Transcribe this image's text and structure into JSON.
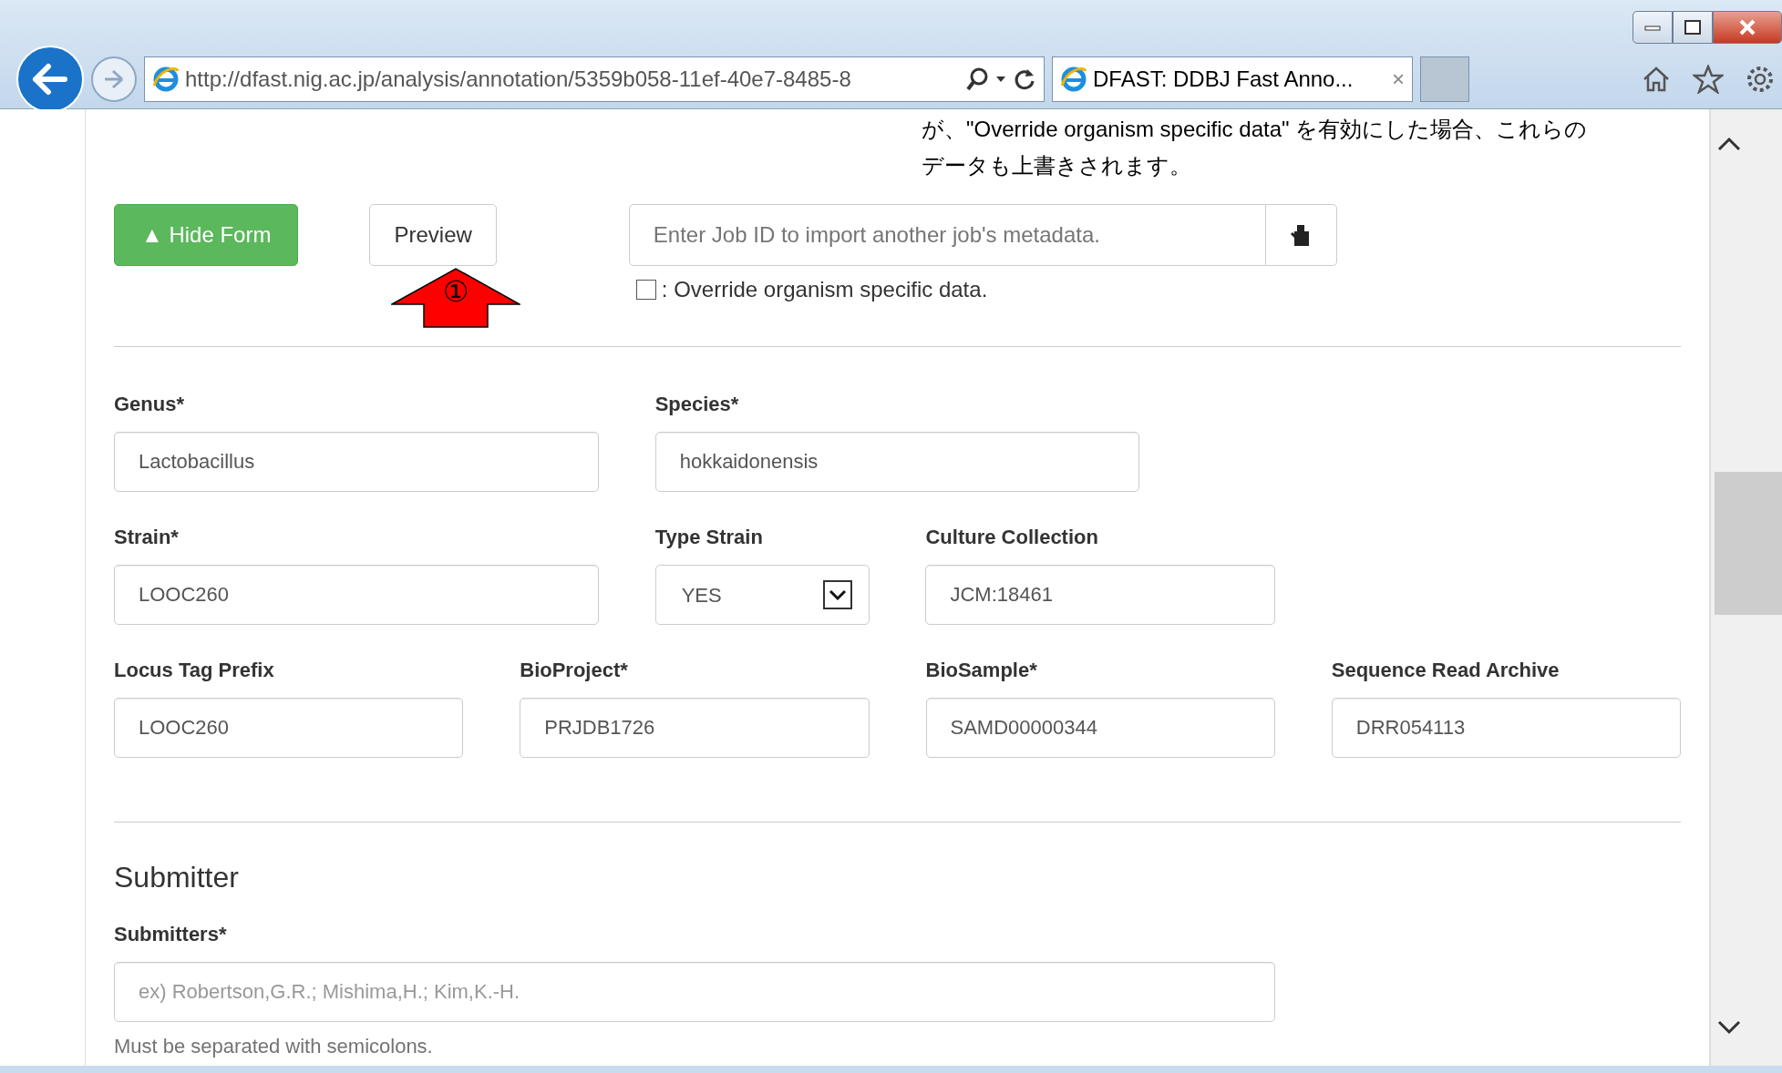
{
  "browser": {
    "address": "http://dfast.nig.ac.jp/analysis/annotation/5359b058-11ef-40e7-8485-8",
    "tab": {
      "title": "DFAST: DDBJ Fast Anno...",
      "close": "×"
    }
  },
  "note": [
    "が、\"Override organism specific data\" を有効にした場合、これらの",
    "データも上書きされます。"
  ],
  "actions": {
    "hide_form": "▲ Hide Form",
    "preview": "Preview",
    "annotation": "①",
    "import": {
      "placeholder": "Enter Job ID to import another job's metadata."
    },
    "override": {
      "label": ": Override organism specific data.",
      "checked": false
    }
  },
  "field_rows": [
    [
      {
        "label": "Genus*",
        "kind": "text",
        "value": "Lactobacillus"
      },
      {
        "label": "Species*",
        "kind": "text",
        "value": "hokkaidonensis"
      }
    ],
    [
      {
        "label": "Strain*",
        "kind": "text",
        "value": "LOOC260"
      },
      {
        "label": "Type Strain",
        "kind": "select",
        "value": "YES"
      },
      {
        "label": "Culture Collection",
        "kind": "text",
        "value": "JCM:18461"
      }
    ],
    [
      {
        "label": "Locus Tag Prefix",
        "kind": "text",
        "value": "LOOC260"
      },
      {
        "label": "BioProject*",
        "kind": "text",
        "value": "PRJDB1726"
      },
      {
        "label": "BioSample*",
        "kind": "text",
        "value": "SAMD00000344"
      },
      {
        "label": "Sequence Read Archive",
        "kind": "text",
        "value": "DRR054113"
      }
    ]
  ],
  "submitter": {
    "heading": "Submitter",
    "label": "Submitters*",
    "placeholder": "ex) Robertson,G.R.; Mishima,H.; Kim,K.-H.",
    "help": "Must be separated with semicolons."
  }
}
